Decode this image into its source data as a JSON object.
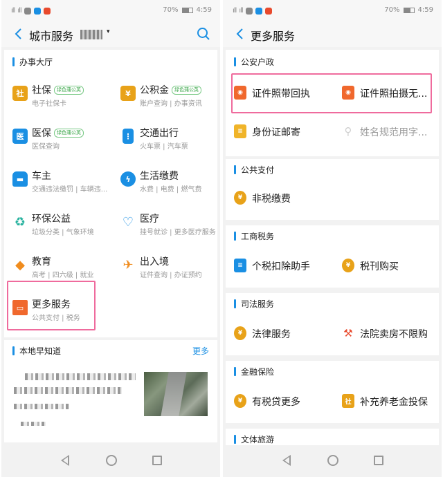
{
  "status": {
    "signal": "4G",
    "battery": "70%",
    "time": "4:59"
  },
  "left": {
    "header": {
      "title": "城市服务",
      "city_caret": "▾"
    },
    "hall": {
      "title": "办事大厅",
      "tag": "绿色蒲公英",
      "items": [
        {
          "name": "社保",
          "sub": "电子社保卡",
          "tagged": true,
          "icon": "shield-social-icon",
          "color": "#e8a219"
        },
        {
          "name": "公积金",
          "sub": "账户查询 | 办事资讯",
          "tagged": true,
          "icon": "yuan-house-icon",
          "color": "#e8a219"
        },
        {
          "name": "医保",
          "sub": "医保查询",
          "tagged": true,
          "icon": "medical-shield-icon",
          "color": "#1a8fe3"
        },
        {
          "name": "交通出行",
          "sub": "火车票 | 汽车票",
          "tagged": false,
          "icon": "traffic-light-icon",
          "color": "#1a8fe3"
        },
        {
          "name": "车主",
          "sub": "交通违法缴罚 | 车辆违...",
          "tagged": false,
          "icon": "car-icon",
          "color": "#1a8fe3"
        },
        {
          "name": "生活缴费",
          "sub": "水费 | 电费 | 燃气费",
          "tagged": false,
          "icon": "bolt-drop-icon",
          "color": "#1a8fe3"
        },
        {
          "name": "环保公益",
          "sub": "垃圾分类 | 气象环境",
          "tagged": false,
          "icon": "recycle-icon",
          "color": "#2bb3a0"
        },
        {
          "name": "医疗",
          "sub": "挂号就诊 | 更多医疗服务",
          "tagged": false,
          "icon": "heart-cross-icon",
          "color": "#1a8fe3"
        },
        {
          "name": "教育",
          "sub": "高考 | 四六级 | 就业",
          "tagged": false,
          "icon": "graduation-cap-icon",
          "color": "#f08c1e"
        },
        {
          "name": "出入境",
          "sub": "证件查询 | 办证预约",
          "tagged": false,
          "icon": "globe-plane-icon",
          "color": "#f08c1e"
        },
        {
          "name": "更多服务",
          "sub": "公共支付 | 税务",
          "tagged": false,
          "icon": "more-box-icon",
          "color": "#f0682d"
        }
      ]
    },
    "news": {
      "title": "本地早知道",
      "more": "更多"
    }
  },
  "right": {
    "header": {
      "title": "更多服务"
    },
    "sections": [
      {
        "title": "公安户政",
        "items": [
          {
            "label": "证件照带回执",
            "icon": "id-photo-icon",
            "color": "#f0682d",
            "dim": false
          },
          {
            "label": "证件照拍摄无...",
            "icon": "id-photo-icon",
            "color": "#f0682d",
            "dim": false
          },
          {
            "label": "身份证邮寄",
            "icon": "id-card-mail-icon",
            "color": "#f0b429",
            "dim": false
          },
          {
            "label": "姓名规范用字...",
            "icon": "name-search-icon",
            "color": "#cfcfcf",
            "dim": true
          }
        ]
      },
      {
        "title": "公共支付",
        "items": [
          {
            "label": "非税缴费",
            "icon": "gold-coin-icon",
            "color": "#e8a219",
            "dim": false
          }
        ]
      },
      {
        "title": "工商税务",
        "items": [
          {
            "label": "个税扣除助手",
            "icon": "tax-doc-icon",
            "color": "#1a8fe3",
            "dim": false
          },
          {
            "label": "税刊购买",
            "icon": "gold-coin-icon",
            "color": "#e8a219",
            "dim": false
          }
        ]
      },
      {
        "title": "司法服务",
        "items": [
          {
            "label": "法律服务",
            "icon": "gold-coin-icon",
            "color": "#e8a219",
            "dim": false
          },
          {
            "label": "法院卖房不限购",
            "icon": "gavel-icon",
            "color": "#e84a2d",
            "dim": false
          }
        ]
      },
      {
        "title": "金融保险",
        "items": [
          {
            "label": "有税贷更多",
            "icon": "gold-coin-icon",
            "color": "#e8a219",
            "dim": false
          },
          {
            "label": "补充养老金投保",
            "icon": "shield-social-icon",
            "color": "#e8a219",
            "dim": false
          }
        ]
      },
      {
        "title": "文体旅游",
        "items": []
      }
    ]
  }
}
